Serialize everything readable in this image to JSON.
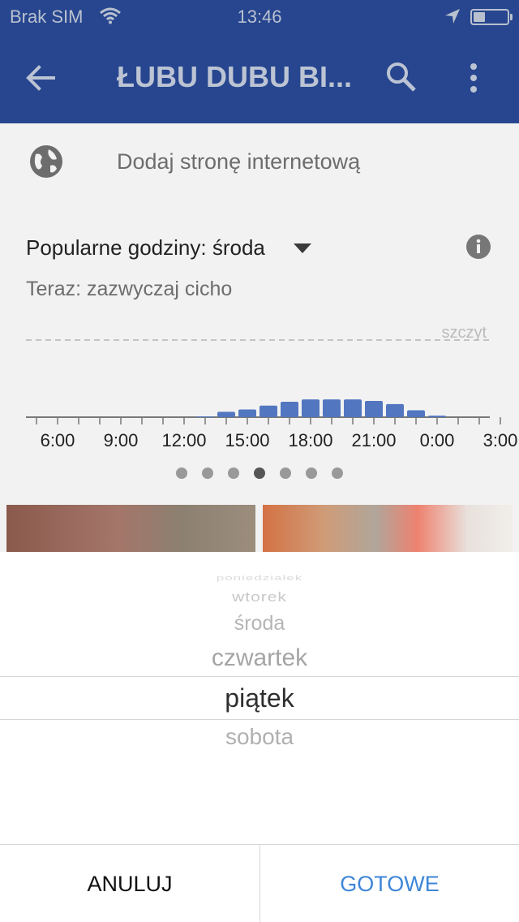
{
  "status_bar": {
    "carrier": "Brak SIM",
    "time": "13:46",
    "battery_level": 0.35
  },
  "app_bar": {
    "title": "ŁUBU DUBU BI..."
  },
  "website_row": {
    "label": "Dodaj stronę internetową"
  },
  "popular_times": {
    "title": "Popularne godziny: środa",
    "status": "Teraz: zazwyczaj cicho",
    "peak_label": "szczyt"
  },
  "chart_data": {
    "type": "bar",
    "x_tick_labels": [
      "6:00",
      "9:00",
      "12:00",
      "15:00",
      "18:00",
      "21:00",
      "0:00",
      "3:00"
    ],
    "hours": [
      5,
      6,
      7,
      8,
      9,
      10,
      11,
      12,
      13,
      14,
      15,
      16,
      17,
      18,
      19,
      20,
      21,
      22,
      23,
      0,
      1,
      2,
      3,
      4
    ],
    "values": [
      0,
      0,
      0,
      0,
      0,
      0,
      0,
      0,
      1,
      7,
      10,
      15,
      20,
      23,
      23,
      23,
      21,
      17,
      9,
      2,
      0,
      0,
      0,
      0
    ],
    "ylim": [
      0,
      100
    ],
    "peak_line": 100,
    "bar_color": "#5277c0",
    "active_page": 3,
    "page_count": 7
  },
  "day_picker": {
    "options": [
      "poniedziałek",
      "wtorek",
      "środa",
      "czwartek",
      "piątek",
      "sobota"
    ],
    "selected": "piątek"
  },
  "buttons": {
    "cancel": "ANULUJ",
    "done": "GOTOWE"
  },
  "colors": {
    "app_bar": "#27468f",
    "accent": "#3e86d8"
  }
}
